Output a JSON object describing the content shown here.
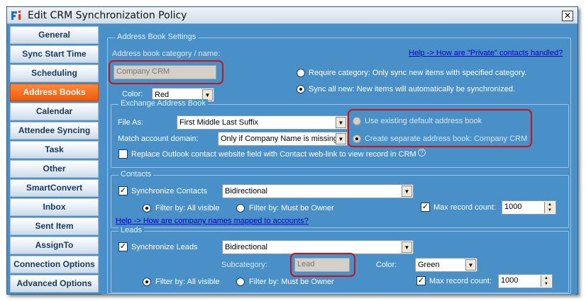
{
  "window": {
    "title": "Edit CRM Synchronization Policy",
    "close_glyph": "✕",
    "app_icon": "fi-logo-icon"
  },
  "sidebar": {
    "items": [
      {
        "label": "General"
      },
      {
        "label": "Sync Start Time"
      },
      {
        "label": "Scheduling"
      },
      {
        "label": "Address Books",
        "active": true
      },
      {
        "label": "Calendar"
      },
      {
        "label": "Attendee Syncing"
      },
      {
        "label": "Task"
      },
      {
        "label": "Other"
      },
      {
        "label": "SmartConvert"
      },
      {
        "label": "Inbox"
      },
      {
        "label": "Sent Item"
      },
      {
        "label": "AssignTo"
      },
      {
        "label": "Connection Options"
      },
      {
        "label": "Advanced Options"
      }
    ]
  },
  "address_book_settings": {
    "group_title": "Address Book Settings",
    "category_label": "Address book category / name:",
    "category_value": "Company CRM",
    "help_link": "Help -> How are \"Private\" contacts handled?",
    "color_label": "Color:",
    "color_value": "Red",
    "radio_require": "Require category: Only sync new items with specified category.",
    "radio_sync_all": "Sync all new: New items will automatically be synchronized."
  },
  "exchange_address_book": {
    "group_title": "Exchange Address Book",
    "file_as_label": "File As:",
    "file_as_value": "First Middle Last Suffix",
    "match_label": "Match account domain:",
    "match_value": "Only if Company Name is missing",
    "radio_use_existing": "Use existing default address book",
    "radio_create_separate": "Create separate address book: Company CRM",
    "replace_label": "Replace Outlook contact website field with Contact web-link to view record in CRM",
    "help_glyph": "?"
  },
  "contacts": {
    "group_title": "Contacts",
    "sync_label": "Synchronize Contacts",
    "direction_value": "Bidirectional",
    "filter_all": "Filter by: All visible",
    "filter_owner": "Filter by: Must be Owner",
    "max_label": "Max record count:",
    "max_value": "1000",
    "help_link": "Help -> How are company names mapped to accounts?"
  },
  "leads": {
    "group_title": "Leads",
    "sync_label": "Synchronize Leads",
    "direction_value": "Bidirectional",
    "subcategory_label": "Subcategory:",
    "subcategory_value": "Lead",
    "color_label": "Color:",
    "color_value": "Green",
    "filter_all": "Filter by: All visible",
    "filter_owner": "Filter by: Must be Owner",
    "max_label": "Max record count:",
    "max_value": "1000"
  },
  "glyphs": {
    "check": "✓",
    "arrow_down": "▼",
    "spin_up": "▲",
    "spin_down": "▼"
  },
  "colors": {
    "panel": "#4a90c8",
    "active_tab": "#ef5b08",
    "highlight_ring": "#d01010",
    "link": "#0000cc"
  }
}
